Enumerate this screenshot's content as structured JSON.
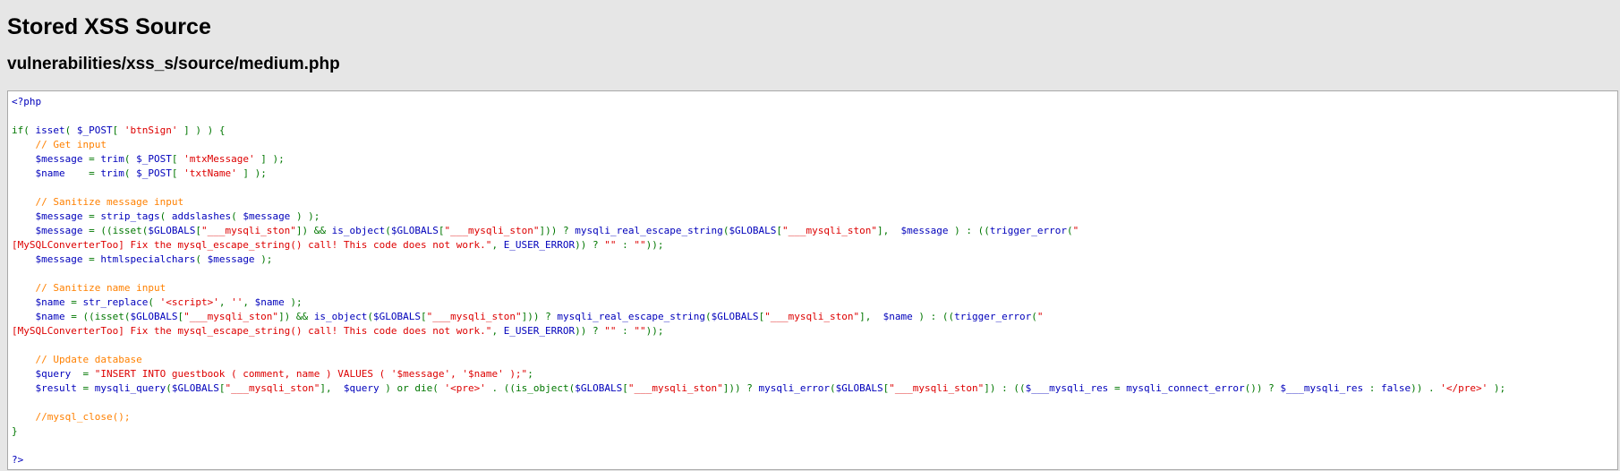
{
  "page": {
    "title": "Stored XSS Source",
    "path": "vulnerabilities/xss_s/source/medium.php"
  },
  "colors": {
    "background": "#e6e6e6",
    "code_bg": "#ffffff",
    "keyword": "#007700",
    "default": "#0000bb",
    "string": "#dd0000",
    "comment": "#ff8000"
  },
  "code_lines": [
    [
      [
        "def",
        "<?php"
      ]
    ],
    [],
    [
      [
        "kw",
        "if( "
      ],
      [
        "def",
        "isset"
      ],
      [
        "kw",
        "( "
      ],
      [
        "def",
        "$_POST"
      ],
      [
        "kw",
        "[ "
      ],
      [
        "str",
        "'btnSign'"
      ],
      [
        "kw",
        " ] ) ) {"
      ]
    ],
    [
      [
        "kw",
        "    "
      ],
      [
        "cmt",
        "// Get input"
      ]
    ],
    [
      [
        "kw",
        "    "
      ],
      [
        "def",
        "$message "
      ],
      [
        "kw",
        "= "
      ],
      [
        "def",
        "trim"
      ],
      [
        "kw",
        "( "
      ],
      [
        "def",
        "$_POST"
      ],
      [
        "kw",
        "[ "
      ],
      [
        "str",
        "'mtxMessage'"
      ],
      [
        "kw",
        " ] );"
      ]
    ],
    [
      [
        "kw",
        "    "
      ],
      [
        "def",
        "$name    "
      ],
      [
        "kw",
        "= "
      ],
      [
        "def",
        "trim"
      ],
      [
        "kw",
        "( "
      ],
      [
        "def",
        "$_POST"
      ],
      [
        "kw",
        "[ "
      ],
      [
        "str",
        "'txtName'"
      ],
      [
        "kw",
        " ] );"
      ]
    ],
    [],
    [
      [
        "kw",
        "    "
      ],
      [
        "cmt",
        "// Sanitize message input"
      ]
    ],
    [
      [
        "kw",
        "    "
      ],
      [
        "def",
        "$message "
      ],
      [
        "kw",
        "= "
      ],
      [
        "def",
        "strip_tags"
      ],
      [
        "kw",
        "( "
      ],
      [
        "def",
        "addslashes"
      ],
      [
        "kw",
        "( "
      ],
      [
        "def",
        "$message "
      ],
      [
        "kw",
        ") );"
      ]
    ],
    [
      [
        "kw",
        "    "
      ],
      [
        "def",
        "$message "
      ],
      [
        "kw",
        "= ((isset("
      ],
      [
        "def",
        "$GLOBALS"
      ],
      [
        "kw",
        "["
      ],
      [
        "str",
        "\"___mysqli_ston\""
      ],
      [
        "kw",
        "]) && "
      ],
      [
        "def",
        "is_object"
      ],
      [
        "kw",
        "("
      ],
      [
        "def",
        "$GLOBALS"
      ],
      [
        "kw",
        "["
      ],
      [
        "str",
        "\"___mysqli_ston\""
      ],
      [
        "kw",
        "])) ? "
      ],
      [
        "def",
        "mysqli_real_escape_string"
      ],
      [
        "kw",
        "("
      ],
      [
        "def",
        "$GLOBALS"
      ],
      [
        "kw",
        "["
      ],
      [
        "str",
        "\"___mysqli_ston\""
      ],
      [
        "kw",
        "],  "
      ],
      [
        "def",
        "$message "
      ],
      [
        "kw",
        ") : (("
      ],
      [
        "def",
        "trigger_error"
      ],
      [
        "kw",
        "("
      ],
      [
        "str",
        "\""
      ]
    ],
    [
      [
        "str",
        "[MySQLConverterToo] Fix the mysql_escape_string() call! This code does not work.\""
      ],
      [
        "kw",
        ", "
      ],
      [
        "def",
        "E_USER_ERROR"
      ],
      [
        "kw",
        ")) ? "
      ],
      [
        "str",
        "\"\""
      ],
      [
        "kw",
        " : "
      ],
      [
        "str",
        "\"\""
      ],
      [
        "kw",
        "));"
      ]
    ],
    [
      [
        "kw",
        "    "
      ],
      [
        "def",
        "$message "
      ],
      [
        "kw",
        "= "
      ],
      [
        "def",
        "htmlspecialchars"
      ],
      [
        "kw",
        "( "
      ],
      [
        "def",
        "$message "
      ],
      [
        "kw",
        ");"
      ]
    ],
    [],
    [
      [
        "kw",
        "    "
      ],
      [
        "cmt",
        "// Sanitize name input"
      ]
    ],
    [
      [
        "kw",
        "    "
      ],
      [
        "def",
        "$name "
      ],
      [
        "kw",
        "= "
      ],
      [
        "def",
        "str_replace"
      ],
      [
        "kw",
        "( "
      ],
      [
        "str",
        "'<script>'"
      ],
      [
        "kw",
        ", "
      ],
      [
        "str",
        "''"
      ],
      [
        "kw",
        ", "
      ],
      [
        "def",
        "$name "
      ],
      [
        "kw",
        ");"
      ]
    ],
    [
      [
        "kw",
        "    "
      ],
      [
        "def",
        "$name "
      ],
      [
        "kw",
        "= ((isset("
      ],
      [
        "def",
        "$GLOBALS"
      ],
      [
        "kw",
        "["
      ],
      [
        "str",
        "\"___mysqli_ston\""
      ],
      [
        "kw",
        "]) && "
      ],
      [
        "def",
        "is_object"
      ],
      [
        "kw",
        "("
      ],
      [
        "def",
        "$GLOBALS"
      ],
      [
        "kw",
        "["
      ],
      [
        "str",
        "\"___mysqli_ston\""
      ],
      [
        "kw",
        "])) ? "
      ],
      [
        "def",
        "mysqli_real_escape_string"
      ],
      [
        "kw",
        "("
      ],
      [
        "def",
        "$GLOBALS"
      ],
      [
        "kw",
        "["
      ],
      [
        "str",
        "\"___mysqli_ston\""
      ],
      [
        "kw",
        "],  "
      ],
      [
        "def",
        "$name "
      ],
      [
        "kw",
        ") : (("
      ],
      [
        "def",
        "trigger_error"
      ],
      [
        "kw",
        "("
      ],
      [
        "str",
        "\""
      ]
    ],
    [
      [
        "str",
        "[MySQLConverterToo] Fix the mysql_escape_string() call! This code does not work.\""
      ],
      [
        "kw",
        ", "
      ],
      [
        "def",
        "E_USER_ERROR"
      ],
      [
        "kw",
        ")) ? "
      ],
      [
        "str",
        "\"\""
      ],
      [
        "kw",
        " : "
      ],
      [
        "str",
        "\"\""
      ],
      [
        "kw",
        "));"
      ]
    ],
    [],
    [
      [
        "kw",
        "    "
      ],
      [
        "cmt",
        "// Update database"
      ]
    ],
    [
      [
        "kw",
        "    "
      ],
      [
        "def",
        "$query  "
      ],
      [
        "kw",
        "= "
      ],
      [
        "str",
        "\"INSERT INTO guestbook ( comment, name ) VALUES ( '$message', '$name' );\""
      ],
      [
        "kw",
        ";"
      ]
    ],
    [
      [
        "kw",
        "    "
      ],
      [
        "def",
        "$result "
      ],
      [
        "kw",
        "= "
      ],
      [
        "def",
        "mysqli_query"
      ],
      [
        "kw",
        "("
      ],
      [
        "def",
        "$GLOBALS"
      ],
      [
        "kw",
        "["
      ],
      [
        "str",
        "\"___mysqli_ston\""
      ],
      [
        "kw",
        "],  "
      ],
      [
        "def",
        "$query "
      ],
      [
        "kw",
        ") or die( "
      ],
      [
        "str",
        "'<pre>' "
      ],
      [
        "kw",
        ". ((is_object("
      ],
      [
        "def",
        "$GLOBALS"
      ],
      [
        "kw",
        "["
      ],
      [
        "str",
        "\"___mysqli_ston\""
      ],
      [
        "kw",
        "])) ? "
      ],
      [
        "def",
        "mysqli_error"
      ],
      [
        "kw",
        "("
      ],
      [
        "def",
        "$GLOBALS"
      ],
      [
        "kw",
        "["
      ],
      [
        "str",
        "\"___mysqli_ston\""
      ],
      [
        "kw",
        "]) : (("
      ],
      [
        "def",
        "$___mysqli_res "
      ],
      [
        "kw",
        "= "
      ],
      [
        "def",
        "mysqli_connect_error"
      ],
      [
        "kw",
        "()) ? "
      ],
      [
        "def",
        "$___mysqli_res "
      ],
      [
        "kw",
        ": "
      ],
      [
        "def",
        "false"
      ],
      [
        "kw",
        ")) . "
      ],
      [
        "str",
        "'</pre>' "
      ],
      [
        "kw",
        ");"
      ]
    ],
    [],
    [
      [
        "kw",
        "    "
      ],
      [
        "cmt",
        "//mysql_close();"
      ]
    ],
    [
      [
        "kw",
        "}"
      ]
    ],
    [],
    [
      [
        "def",
        "?>"
      ]
    ]
  ]
}
